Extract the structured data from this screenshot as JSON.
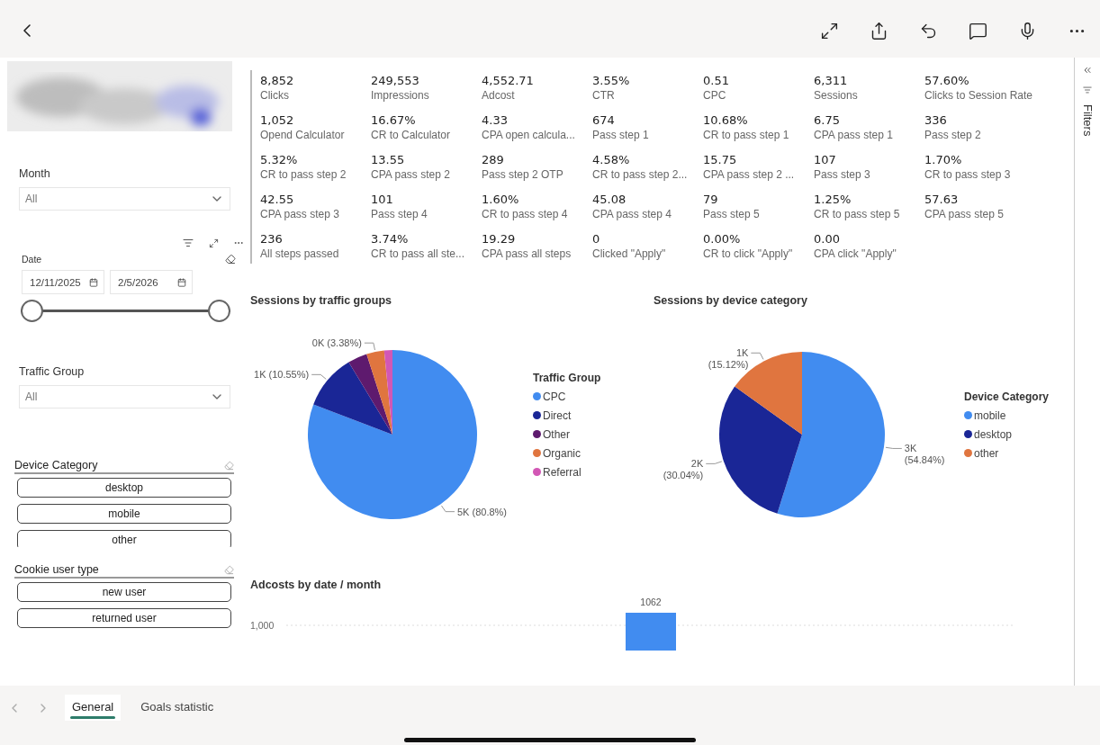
{
  "filters": {
    "month": {
      "label": "Month",
      "value": "All"
    },
    "date": {
      "label": "Date",
      "start": "12/11/2025",
      "end": "2/5/2026",
      "level": 1
    },
    "traffic_group": {
      "label": "Traffic Group",
      "value": "All"
    },
    "device_category": {
      "label": "Device Category",
      "items": [
        "desktop",
        "mobile",
        "other"
      ]
    },
    "cookie_user_type": {
      "label": "Cookie user type",
      "items": [
        "new user",
        "returned user"
      ]
    }
  },
  "kpis": [
    {
      "value": "8,852",
      "label": "Clicks"
    },
    {
      "value": "249,553",
      "label": "Impressions"
    },
    {
      "value": "4,552.71",
      "label": "Adcost"
    },
    {
      "value": "3.55%",
      "label": "CTR"
    },
    {
      "value": "0.51",
      "label": "CPC"
    },
    {
      "value": "6,311",
      "label": "Sessions"
    },
    {
      "value": "57.60%",
      "label": "Clicks to Session Rate"
    },
    {
      "value": "1,052",
      "label": "Opend Calculator"
    },
    {
      "value": "16.67%",
      "label": "CR to Calculator"
    },
    {
      "value": "4.33",
      "label": "CPA open calcula..."
    },
    {
      "value": "674",
      "label": "Pass step 1"
    },
    {
      "value": "10.68%",
      "label": "CR to pass step 1"
    },
    {
      "value": "6.75",
      "label": "CPA pass step 1"
    },
    {
      "value": "336",
      "label": "Pass step 2"
    },
    {
      "value": "5.32%",
      "label": "CR to pass step 2"
    },
    {
      "value": "13.55",
      "label": "CPA pass step 2"
    },
    {
      "value": "289",
      "label": "Pass step 2 OTP"
    },
    {
      "value": "4.58%",
      "label": "CR to pass step 2..."
    },
    {
      "value": "15.75",
      "label": "CPA pass step 2 ..."
    },
    {
      "value": "107",
      "label": "Pass step 3"
    },
    {
      "value": "1.70%",
      "label": "CR to pass step 3"
    },
    {
      "value": "42.55",
      "label": "CPA pass step 3"
    },
    {
      "value": "101",
      "label": "Pass step 4"
    },
    {
      "value": "1.60%",
      "label": "CR to pass step 4"
    },
    {
      "value": "45.08",
      "label": "CPA pass step 4"
    },
    {
      "value": "79",
      "label": "Pass step 5"
    },
    {
      "value": "1.25%",
      "label": "CR to pass step 5"
    },
    {
      "value": "57.63",
      "label": "CPA pass step 5"
    },
    {
      "value": "236",
      "label": "All steps passed"
    },
    {
      "value": "3.74%",
      "label": "CR to pass all ste..."
    },
    {
      "value": "19.29",
      "label": "CPA pass all steps"
    },
    {
      "value": "0",
      "label": "Clicked \"Apply\""
    },
    {
      "value": "0.00%",
      "label": "CR to click \"Apply\""
    },
    {
      "value": "0.00",
      "label": "CPA click \"Apply\""
    }
  ],
  "traffic_chart": {
    "legend_title": "Traffic Group",
    "chart_data": {
      "type": "pie",
      "title": "Sessions by traffic groups",
      "categories": [
        "CPC",
        "Direct",
        "Other",
        "Organic",
        "Referral"
      ],
      "values": [
        80.8,
        10.55,
        3.7,
        3.38,
        1.57
      ],
      "colors": [
        "#418cf0",
        "#1a2696",
        "#5e1a6e",
        "#e0753f",
        "#d257b5"
      ],
      "value_labels": [
        "5K (80.8%)",
        "1K (10.55%)",
        null,
        "0K (3.38%)",
        null
      ]
    }
  },
  "device_chart": {
    "legend_title": "Device Category",
    "chart_data": {
      "type": "pie",
      "title": "Sessions by device category",
      "categories": [
        "mobile",
        "desktop",
        "other"
      ],
      "values": [
        54.84,
        30.04,
        15.12
      ],
      "colors": [
        "#418cf0",
        "#1a2696",
        "#e0753f"
      ],
      "value_labels": [
        "3K (54.84%)",
        "2K (30.04%)",
        "1K (15.12%)"
      ]
    }
  },
  "adcost_chart": {
    "title": "Adcosts by date / month",
    "gridline_label": "1,000",
    "bar_label": "1062"
  },
  "filters_pane": {
    "label": "Filters"
  },
  "page_tabs": [
    {
      "label": "General",
      "selected": true
    },
    {
      "label": "Goals statistic",
      "selected": false
    }
  ]
}
